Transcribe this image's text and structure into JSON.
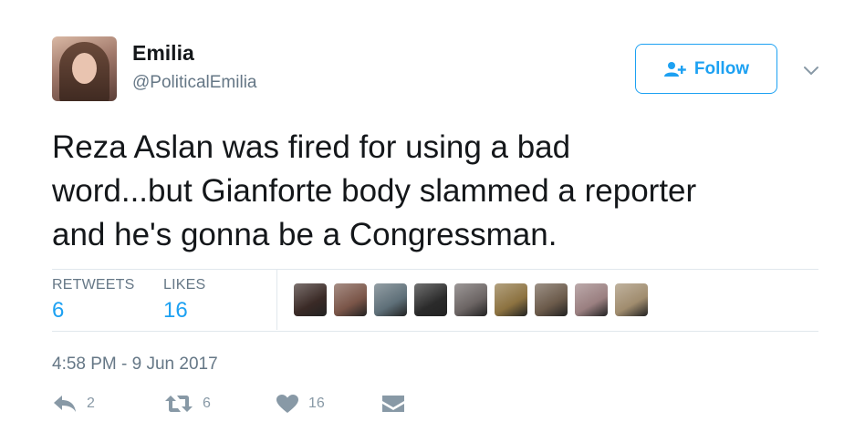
{
  "author": {
    "name": "Emilia",
    "handle": "@PoliticalEmilia"
  },
  "follow_button": {
    "label": "Follow"
  },
  "tweet": {
    "text_lines": [
      "Reza Aslan was fired for using a bad",
      "word...but Gianforte body slammed a reporter",
      "and he's gonna be a Congressman."
    ],
    "timestamp": "4:58 PM - 9 Jun 2017"
  },
  "stats": {
    "retweets_label": "RETWEETS",
    "retweets_value": "6",
    "likes_label": "LIKES",
    "likes_value": "16"
  },
  "actions": {
    "reply_count": "2",
    "retweet_count": "6",
    "like_count": "16"
  },
  "colors": {
    "accent": "#1da1f2",
    "muted": "#657786",
    "icon": "#8899a6",
    "divider": "#e1e8ed"
  },
  "likers": [
    {
      "icon": "user-avatar-1",
      "color": "#3a2a26"
    },
    {
      "icon": "user-avatar-2",
      "color": "#7a5548"
    },
    {
      "icon": "user-avatar-3",
      "color": "#5e6f78"
    },
    {
      "icon": "user-avatar-4",
      "color": "#2b2b2b"
    },
    {
      "icon": "user-avatar-5",
      "color": "#6b6463"
    },
    {
      "icon": "user-avatar-6",
      "color": "#8c7240"
    },
    {
      "icon": "user-avatar-7",
      "color": "#6b5a4a"
    },
    {
      "icon": "user-avatar-8",
      "color": "#9a7f80"
    },
    {
      "icon": "user-avatar-9",
      "color": "#a08c6e"
    }
  ]
}
